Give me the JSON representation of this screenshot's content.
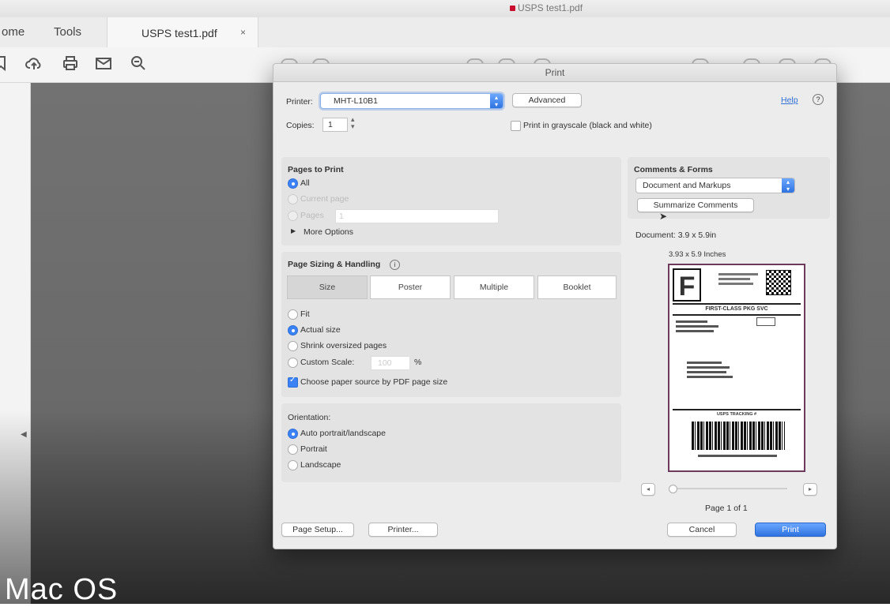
{
  "window": {
    "title": "USPS test1.pdf"
  },
  "tabs": {
    "home": "ome",
    "tools": "Tools",
    "document": "USPS test1.pdf",
    "close_glyph": "×"
  },
  "toolbar": {
    "icons": [
      "bookmark-icon",
      "upload-cloud-icon",
      "print-icon",
      "email-icon",
      "zoom-out-icon"
    ]
  },
  "watermark": "Mac OS",
  "dialog": {
    "title": "Print",
    "printer_label": "Printer:",
    "printer_value": "MHT-L10B1",
    "advanced_button": "Advanced",
    "help_link": "Help",
    "copies_label": "Copies:",
    "copies_value": "1",
    "grayscale_label": "Print in grayscale (black and white)",
    "pages_to_print": {
      "title": "Pages to Print",
      "all": "All",
      "current_page": "Current page",
      "pages": "Pages",
      "pages_value": "1",
      "more_options": "More Options"
    },
    "page_sizing": {
      "title": "Page Sizing & Handling",
      "segments": [
        "Size",
        "Poster",
        "Multiple",
        "Booklet"
      ],
      "fit": "Fit",
      "actual_size": "Actual size",
      "shrink": "Shrink oversized pages",
      "custom_scale": "Custom Scale:",
      "custom_scale_value": "100",
      "percent": "%",
      "paper_source": "Choose paper source by PDF page size"
    },
    "orientation": {
      "title": "Orientation:",
      "auto": "Auto portrait/landscape",
      "portrait": "Portrait",
      "landscape": "Landscape"
    },
    "comments_forms": {
      "title": "Comments & Forms",
      "value": "Document and Markups",
      "summarize_button": "Summarize Comments"
    },
    "preview": {
      "document_size": "Document: 3.9 x 5.9in",
      "sheet_size": "3.93 x 5.9 Inches",
      "label_letter": "F",
      "service": "FIRST-CLASS PKG SVC",
      "tracking_title": "USPS TRACKING #",
      "page_indicator": "Page 1 of 1",
      "prev": "◂",
      "next": "▸"
    },
    "buttons": {
      "page_setup": "Page Setup...",
      "printer": "Printer...",
      "cancel": "Cancel",
      "print": "Print"
    }
  }
}
